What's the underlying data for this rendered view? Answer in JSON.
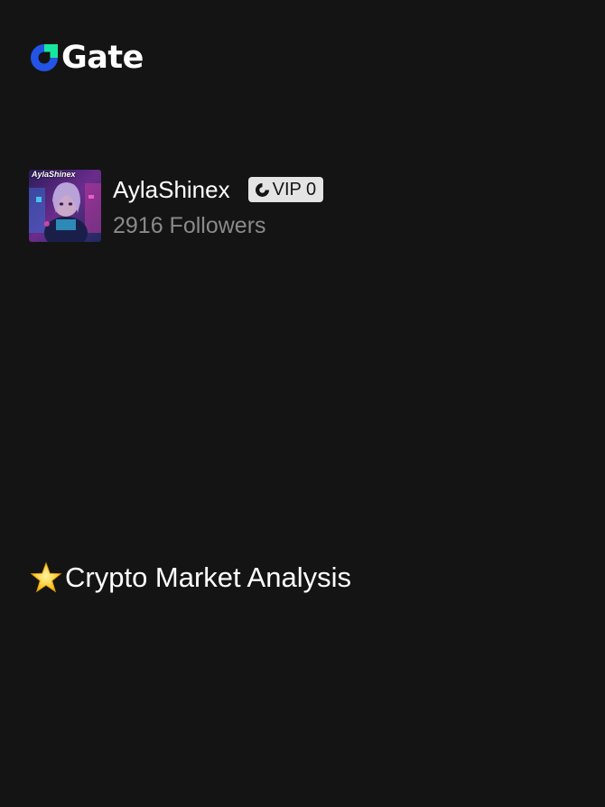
{
  "brand": {
    "name": "Gate",
    "accent_blue": "#2354e6",
    "accent_green": "#17e6a1",
    "logo_icon": "gate-logo-icon"
  },
  "profile": {
    "avatar_caption": "AylaShinex",
    "username": "AylaShinex",
    "vip_label": "VIP 0",
    "vip_icon": "gate-mark-icon",
    "followers": "2916 Followers"
  },
  "post": {
    "title_icon": "star-icon",
    "title": "Crypto Market Analysis"
  },
  "colors": {
    "background": "#141414",
    "text_primary": "#ffffff",
    "text_secondary": "#8a8a8a",
    "badge_bg": "#e4e4e4"
  }
}
